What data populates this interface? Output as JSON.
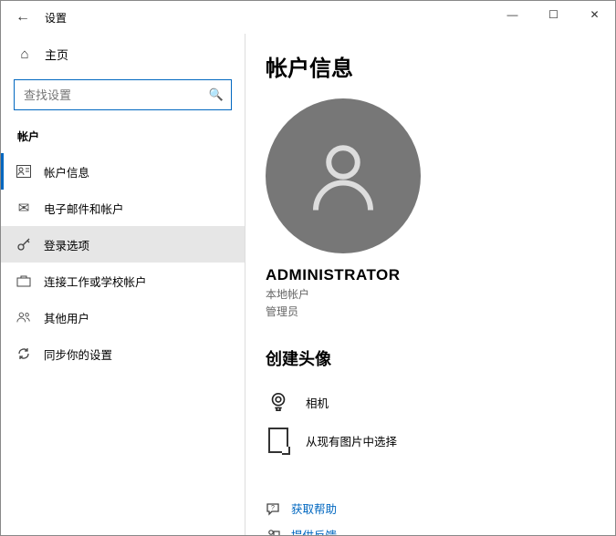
{
  "window": {
    "title": "设置"
  },
  "caption": {
    "minimize": "—",
    "maximize": "☐",
    "close": "✕"
  },
  "sidebar": {
    "home": "主页",
    "search_placeholder": "查找设置",
    "section": "帐户",
    "items": [
      {
        "label": "帐户信息"
      },
      {
        "label": "电子邮件和帐户"
      },
      {
        "label": "登录选项"
      },
      {
        "label": "连接工作或学校帐户"
      },
      {
        "label": "其他用户"
      },
      {
        "label": "同步你的设置"
      }
    ]
  },
  "content": {
    "heading": "帐户信息",
    "username": "ADMINISTRATOR",
    "account_type": "本地帐户",
    "role": "管理员",
    "create_avatar_heading": "创建头像",
    "options": {
      "camera": "相机",
      "browse": "从现有图片中选择"
    },
    "links": {
      "help": "获取帮助",
      "feedback": "提供反馈"
    }
  }
}
